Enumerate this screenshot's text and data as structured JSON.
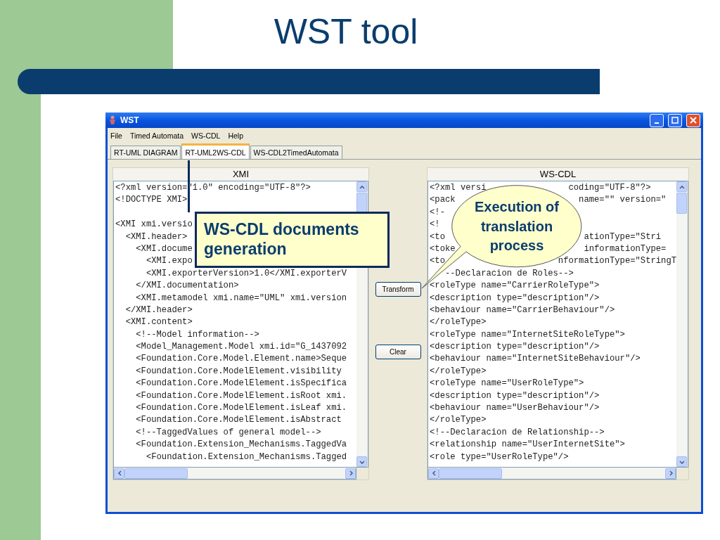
{
  "slide": {
    "title": "WST tool"
  },
  "window": {
    "title": "WST"
  },
  "menu": [
    "File",
    "Timed Automata",
    "WS-CDL",
    "Help"
  ],
  "tabs": [
    {
      "label": "RT-UML DIAGRAM",
      "selected": false
    },
    {
      "label": "RT-UML2WS-CDL",
      "selected": true
    },
    {
      "label": "WS-CDL2TimedAutomata",
      "selected": false
    }
  ],
  "xmi_panel": {
    "title": "XMI",
    "lines": [
      {
        "text": "<?xml version=\"1.0\" encoding=\"UTF-8\"?>"
      },
      {
        "text": "<!DOCTYPE XMI>"
      },
      {
        "text": "<XMI xmi.versio",
        "blank_before": true
      },
      {
        "text": "  <XMI.header>"
      },
      {
        "text": "    <XMI.docume"
      },
      {
        "text": "      <XMI.expo"
      },
      {
        "text": "      <XMI.exporterVersion>1.0</XMI.exporterV"
      },
      {
        "text": "    </XMI.documentation>"
      },
      {
        "text": "    <XMI.metamodel xmi.name=\"UML\" xmi.version"
      },
      {
        "text": "  </XMI.header>"
      },
      {
        "text": "  <XMI.content>"
      },
      {
        "text": "    <!--Model information-->"
      },
      {
        "text": "    <Model_Management.Model xmi.id=\"G_1437092"
      },
      {
        "text": "    <Foundation.Core.Model.Element.name>Seque"
      },
      {
        "text": "    <Foundation.Core.ModelElement.visibility"
      },
      {
        "text": "    <Foundation.Core.ModelElement.isSpecifica"
      },
      {
        "text": "    <Foundation.Core.ModelElement.isRoot xmi."
      },
      {
        "text": "    <Foundation.Core.ModelElement.isLeaf xmi."
      },
      {
        "text": "    <Foundation.Core.ModelElement.isAbstract"
      },
      {
        "text": "    <!--TaggedValues of general model-->"
      },
      {
        "text": "    <Foundation.Extension_Mechanisms.TaggedVa"
      },
      {
        "text": "      <Foundation.Extension_Mechanisms.Tagged"
      }
    ]
  },
  "buttons": [
    "Transform",
    "Clear"
  ],
  "wscdl_panel": {
    "title": "WS-CDL",
    "lines": [
      {
        "text": "<?xml versi",
        "rest": "coding=\"UTF-8\"?>"
      },
      {
        "text": "<pack",
        "rest": "name=\"\" version=\""
      },
      {
        "text": "<!-"
      },
      {
        "text": "<!"
      },
      {
        "text": "<to",
        "rest": "ationType=\"Stri"
      },
      {
        "text": "<toke",
        "rest": "informationType="
      },
      {
        "text": "<to",
        "rest": "nformationType=\"StringT"
      },
      {
        "text": "   --Declaracion de Roles-->"
      },
      {
        "text": "<roleType name=\"CarrierRoleType\">"
      },
      {
        "text": "<description type=\"description\"/>"
      },
      {
        "text": "<behaviour name=\"CarrierBehaviour\"/>"
      },
      {
        "text": "</roleType>"
      },
      {
        "text": "<roleType name=\"InternetSiteRoleType\">"
      },
      {
        "text": "<description type=\"description\"/>"
      },
      {
        "text": "<behaviour name=\"InternetSiteBehaviour\"/>"
      },
      {
        "text": "</roleType>"
      },
      {
        "text": "<roleType name=\"UserRoleType\">"
      },
      {
        "text": "<description type=\"description\"/>"
      },
      {
        "text": "<behaviour name=\"UserBehaviour\"/>"
      },
      {
        "text": "</roleType>"
      },
      {
        "text": "<!--Declaracion de Relationship-->"
      },
      {
        "text": "<relationship name=\"UserInternetSite\">"
      },
      {
        "text": "<role type=\"UserRoleType\"/>"
      }
    ]
  },
  "callouts": [
    {
      "kind": "box",
      "text": "WS-CDL documents generation"
    },
    {
      "kind": "bubble",
      "text": "Execution of translation process"
    }
  ]
}
